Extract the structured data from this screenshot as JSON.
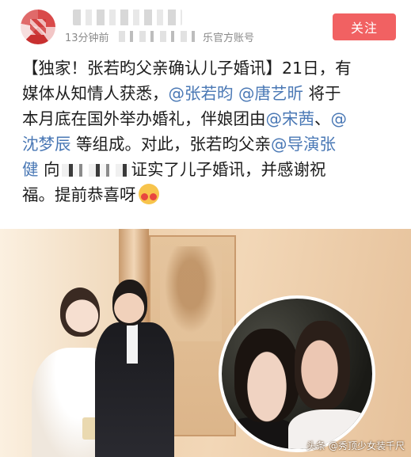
{
  "header": {
    "time": "13分钟前",
    "account_suffix": "乐官方账号",
    "follow_button": "关注"
  },
  "post": {
    "line1": "【独家！张若昀父亲确认儿子婚讯】21日，有",
    "line2_a": "媒体从知情人获悉，",
    "mention1": "@张若昀",
    "mention2": "@唐艺昕",
    "line2_b": " 将于",
    "line3_a": "本月底在国外举办婚礼，伴娘团由",
    "mention3": "@宋茜",
    "line3_b": "、",
    "mention4_a": "@",
    "mention4_b": "沈梦辰",
    "line4_b": " 等组成。对此，张若昀父亲",
    "mention5": "@导演张",
    "mention5_b": "健",
    "line5_a": " 向",
    "line5_b": "证实了儿子婚讯，并感谢祝",
    "line6": "福。提前恭喜呀"
  },
  "photo": {
    "watermark": "头条 @秀顶少女装千尺"
  },
  "colors": {
    "follow_bg": "#f16162",
    "mention": "#4a78b5"
  }
}
